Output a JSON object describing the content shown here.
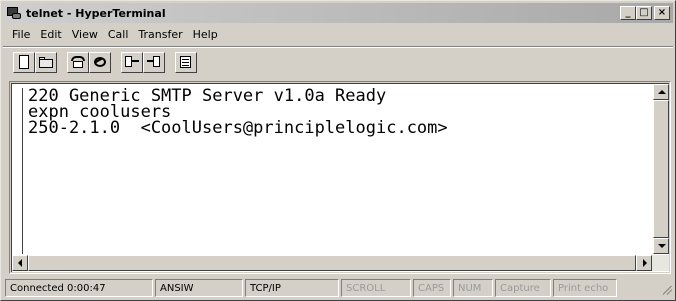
{
  "window": {
    "title": "telnet - HyperTerminal",
    "controls": {
      "minimize": "_",
      "maximize": "□",
      "close": "×"
    }
  },
  "menu": [
    "File",
    "Edit",
    "View",
    "Call",
    "Transfer",
    "Help"
  ],
  "toolbar": {
    "buttons": [
      "new-icon",
      "open-icon",
      "call-icon",
      "disconnect-icon",
      "send-icon",
      "receive-icon",
      "properties-icon"
    ]
  },
  "terminal": {
    "lines": [
      "220 Generic SMTP Server v1.0a Ready",
      "expn coolusers",
      "250-2.1.0  <CoolUsers@principlelogic.com>"
    ]
  },
  "status": {
    "connected": "Connected 0:00:47",
    "emulation": "ANSIW",
    "protocol": "TCP/IP",
    "scroll": "SCROLL",
    "caps": "CAPS",
    "num": "NUM",
    "capture": "Capture",
    "print_echo": "Print echo"
  }
}
